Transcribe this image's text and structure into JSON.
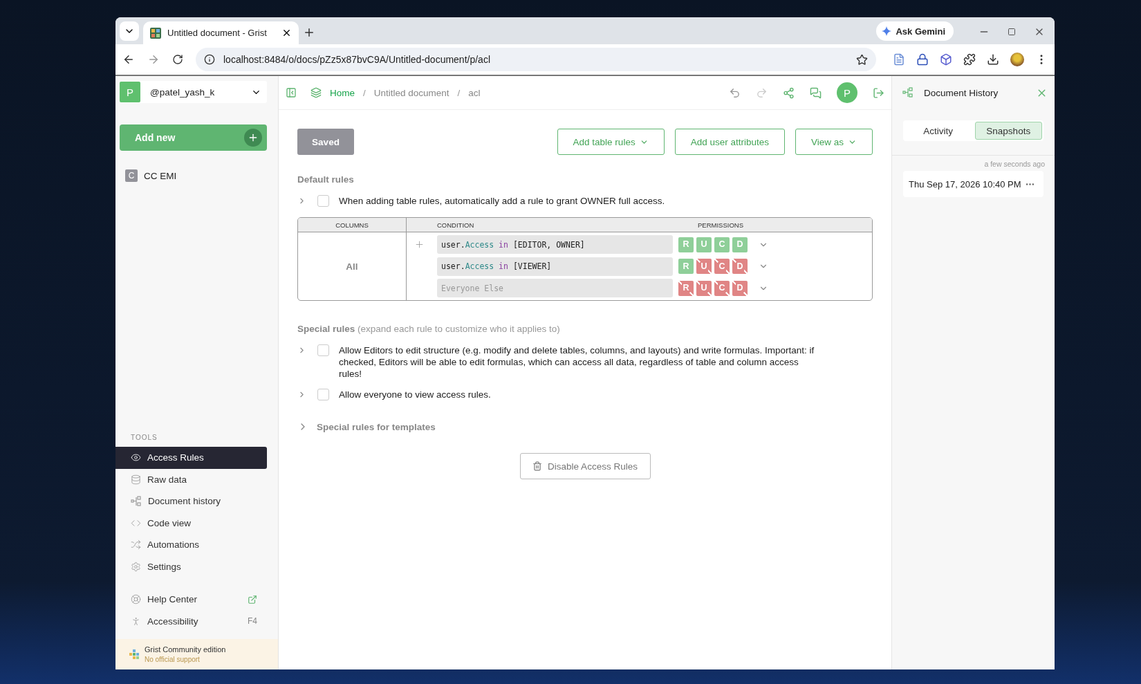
{
  "browser": {
    "tab_title": "Untitled document - Grist",
    "url": "localhost:8484/o/docs/pZz5x87bvC9A/Untitled-document/p/acl",
    "gemini": "Ask Gemini"
  },
  "sidebar": {
    "account": {
      "initial": "P",
      "name": "@patel_yash_k"
    },
    "add_new": "Add new",
    "pages": [
      {
        "initial": "C",
        "label": "CC EMI"
      }
    ],
    "tools_heading": "TOOLS",
    "tools": [
      {
        "kind": "eye",
        "label": "Access Rules",
        "selected": true
      },
      {
        "kind": "database",
        "label": "Raw data",
        "selected": false
      },
      {
        "kind": "history",
        "label": "Document history",
        "selected": false
      },
      {
        "kind": "code",
        "label": "Code view",
        "selected": false
      },
      {
        "kind": "shuffle",
        "label": "Automations",
        "selected": false
      },
      {
        "kind": "settings",
        "label": "Settings",
        "selected": false
      }
    ],
    "help": [
      {
        "kind": "help",
        "label": "Help Center"
      },
      {
        "kind": "accessibility",
        "label": "Accessibility",
        "shortcut": "F4"
      }
    ],
    "footer": {
      "title": "Grist Community edition",
      "subtitle": "No official support"
    }
  },
  "topbar": {
    "breadcrumb": [
      "Home",
      "Untitled document",
      "acl"
    ],
    "separator": "/",
    "avatar": "P"
  },
  "rules": {
    "status": "Saved",
    "actions": [
      {
        "label": "Add table rules",
        "dropdown": true
      },
      {
        "label": "Add user attributes",
        "dropdown": false
      },
      {
        "label": "View as",
        "dropdown": true
      }
    ],
    "default_heading": "Default rules",
    "default_options": [
      {
        "label": "When adding table rules, automatically add a rule to grant OWNER full access.",
        "checked": false
      }
    ],
    "table": {
      "columns_header": "COLUMNS",
      "condition_header": "CONDITION",
      "permissions_header": "PERMISSIONS",
      "column_value": "All",
      "rows": [
        {
          "condition": [
            {
              "kind": "plain",
              "text": "user."
            },
            {
              "kind": "attr",
              "text": "Access"
            },
            {
              "kind": "keyword",
              "text": " in"
            },
            {
              "kind": "plain",
              "text": " [EDITOR, OWNER]"
            }
          ],
          "permissions": [
            {
              "letter": "R",
              "allowed": true
            },
            {
              "letter": "U",
              "allowed": true
            },
            {
              "letter": "C",
              "allowed": true
            },
            {
              "letter": "D",
              "allowed": true
            }
          ]
        },
        {
          "condition": [
            {
              "kind": "plain",
              "text": "user."
            },
            {
              "kind": "attr",
              "text": "Access"
            },
            {
              "kind": "keyword",
              "text": " in"
            },
            {
              "kind": "plain",
              "text": " [VIEWER]"
            }
          ],
          "permissions": [
            {
              "letter": "R",
              "allowed": true
            },
            {
              "letter": "U",
              "allowed": false
            },
            {
              "letter": "C",
              "allowed": false
            },
            {
              "letter": "D",
              "allowed": false
            }
          ]
        },
        {
          "placeholder": "Everyone Else",
          "permissions": [
            {
              "letter": "R",
              "allowed": false
            },
            {
              "letter": "U",
              "allowed": false
            },
            {
              "letter": "C",
              "allowed": false
            },
            {
              "letter": "D",
              "allowed": false
            }
          ]
        }
      ]
    },
    "special_heading": "**Special rules** (expand each rule to customize who it applies to)",
    "special_options": [
      {
        "label": "Allow Editors to edit structure (e.g. modify and delete tables, columns, and layouts) and write formulas. Important: if checked, Editors will be able to edit formulas, which can access all data, regardless of table and column access rules!",
        "checked": false
      },
      {
        "label": "Allow everyone to view access rules.",
        "checked": false
      }
    ],
    "templates": "Special rules for templates",
    "disable": "Disable Access Rules"
  },
  "history": {
    "title": "Document History",
    "tabs": [
      {
        "label": "Activity",
        "selected": false
      },
      {
        "label": "Snapshots",
        "selected": true
      }
    ],
    "time": "a few seconds ago",
    "snapshot": "Thu Sep 17, 2026 10:40 PM"
  }
}
